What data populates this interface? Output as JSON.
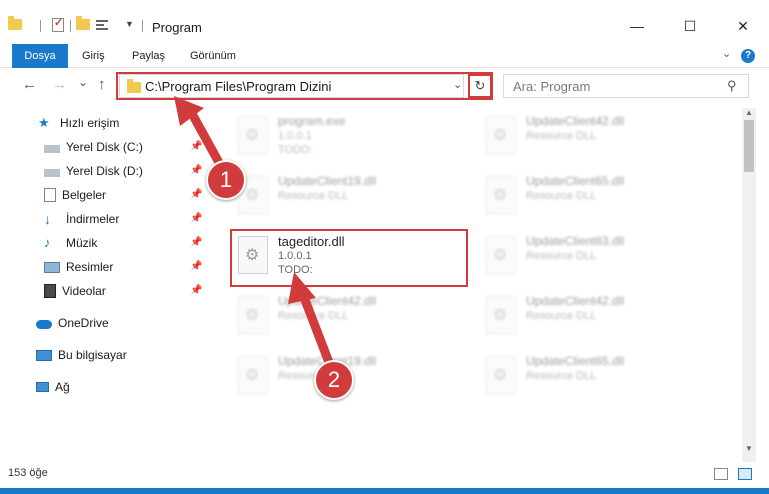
{
  "window": {
    "title": "Program",
    "minimize": "—",
    "maximize": "☐",
    "close": "✕"
  },
  "ribbon": {
    "tabs": [
      "Dosya",
      "Giriş",
      "Paylaş",
      "Görünüm"
    ],
    "help": "?"
  },
  "nav": {
    "back": "←",
    "forward": "→",
    "recent": "⌄",
    "up": "↑",
    "address": "C:\\Program Files\\Program Dizini",
    "refresh": "↻",
    "search_placeholder": "Ara: Program",
    "search_icon": "⚲"
  },
  "sidebar": {
    "items": [
      {
        "label": "Hızlı erişim",
        "icon": "star-icon",
        "pinned": false
      },
      {
        "label": "Yerel Disk (C:)",
        "icon": "drive-icon",
        "pinned": true
      },
      {
        "label": "Yerel Disk (D:)",
        "icon": "drive-icon",
        "pinned": true
      },
      {
        "label": "Belgeler",
        "icon": "document-icon",
        "pinned": true
      },
      {
        "label": "İndirmeler",
        "icon": "download-icon",
        "pinned": true
      },
      {
        "label": "Müzik",
        "icon": "music-icon",
        "pinned": true
      },
      {
        "label": "Resimler",
        "icon": "pictures-icon",
        "pinned": true
      },
      {
        "label": "Videolar",
        "icon": "video-icon",
        "pinned": true
      },
      {
        "label": "OneDrive",
        "icon": "cloud-icon",
        "pinned": false
      },
      {
        "label": "Bu bilgisayar",
        "icon": "computer-icon",
        "pinned": false
      },
      {
        "label": "Ağ",
        "icon": "network-icon",
        "pinned": false
      }
    ]
  },
  "files": [
    {
      "name": "program.exe",
      "line2": "1.0.0.1",
      "line3": "TODO:"
    },
    {
      "name": "UpdateClient42.dll",
      "line2": "Resource DLL",
      "line3": ""
    },
    {
      "name": "UpdateClient19.dll",
      "line2": "Resource DLL",
      "line3": ""
    },
    {
      "name": "UpdateClient65.dll",
      "line2": "Resource DLL",
      "line3": ""
    },
    {
      "name": "tageditor.dll",
      "line2": "1.0.0.1",
      "line3": "TODO:"
    },
    {
      "name": "UpdateClient63.dll",
      "line2": "Resource DLL",
      "line3": ""
    },
    {
      "name": "UpdateClient42.dll",
      "line2": "Resource DLL",
      "line3": ""
    },
    {
      "name": "UpdateClient42.dll",
      "line2": "Resource DLL",
      "line3": ""
    },
    {
      "name": "UpdateClient19.dll",
      "line2": "Resource DLL",
      "line3": ""
    },
    {
      "name": "UpdateClient65.dll",
      "line2": "Resource DLL",
      "line3": ""
    }
  ],
  "annotations": {
    "step1": "1",
    "step2": "2",
    "color": "#d23b3b"
  },
  "status": {
    "count": "153 öğe"
  }
}
